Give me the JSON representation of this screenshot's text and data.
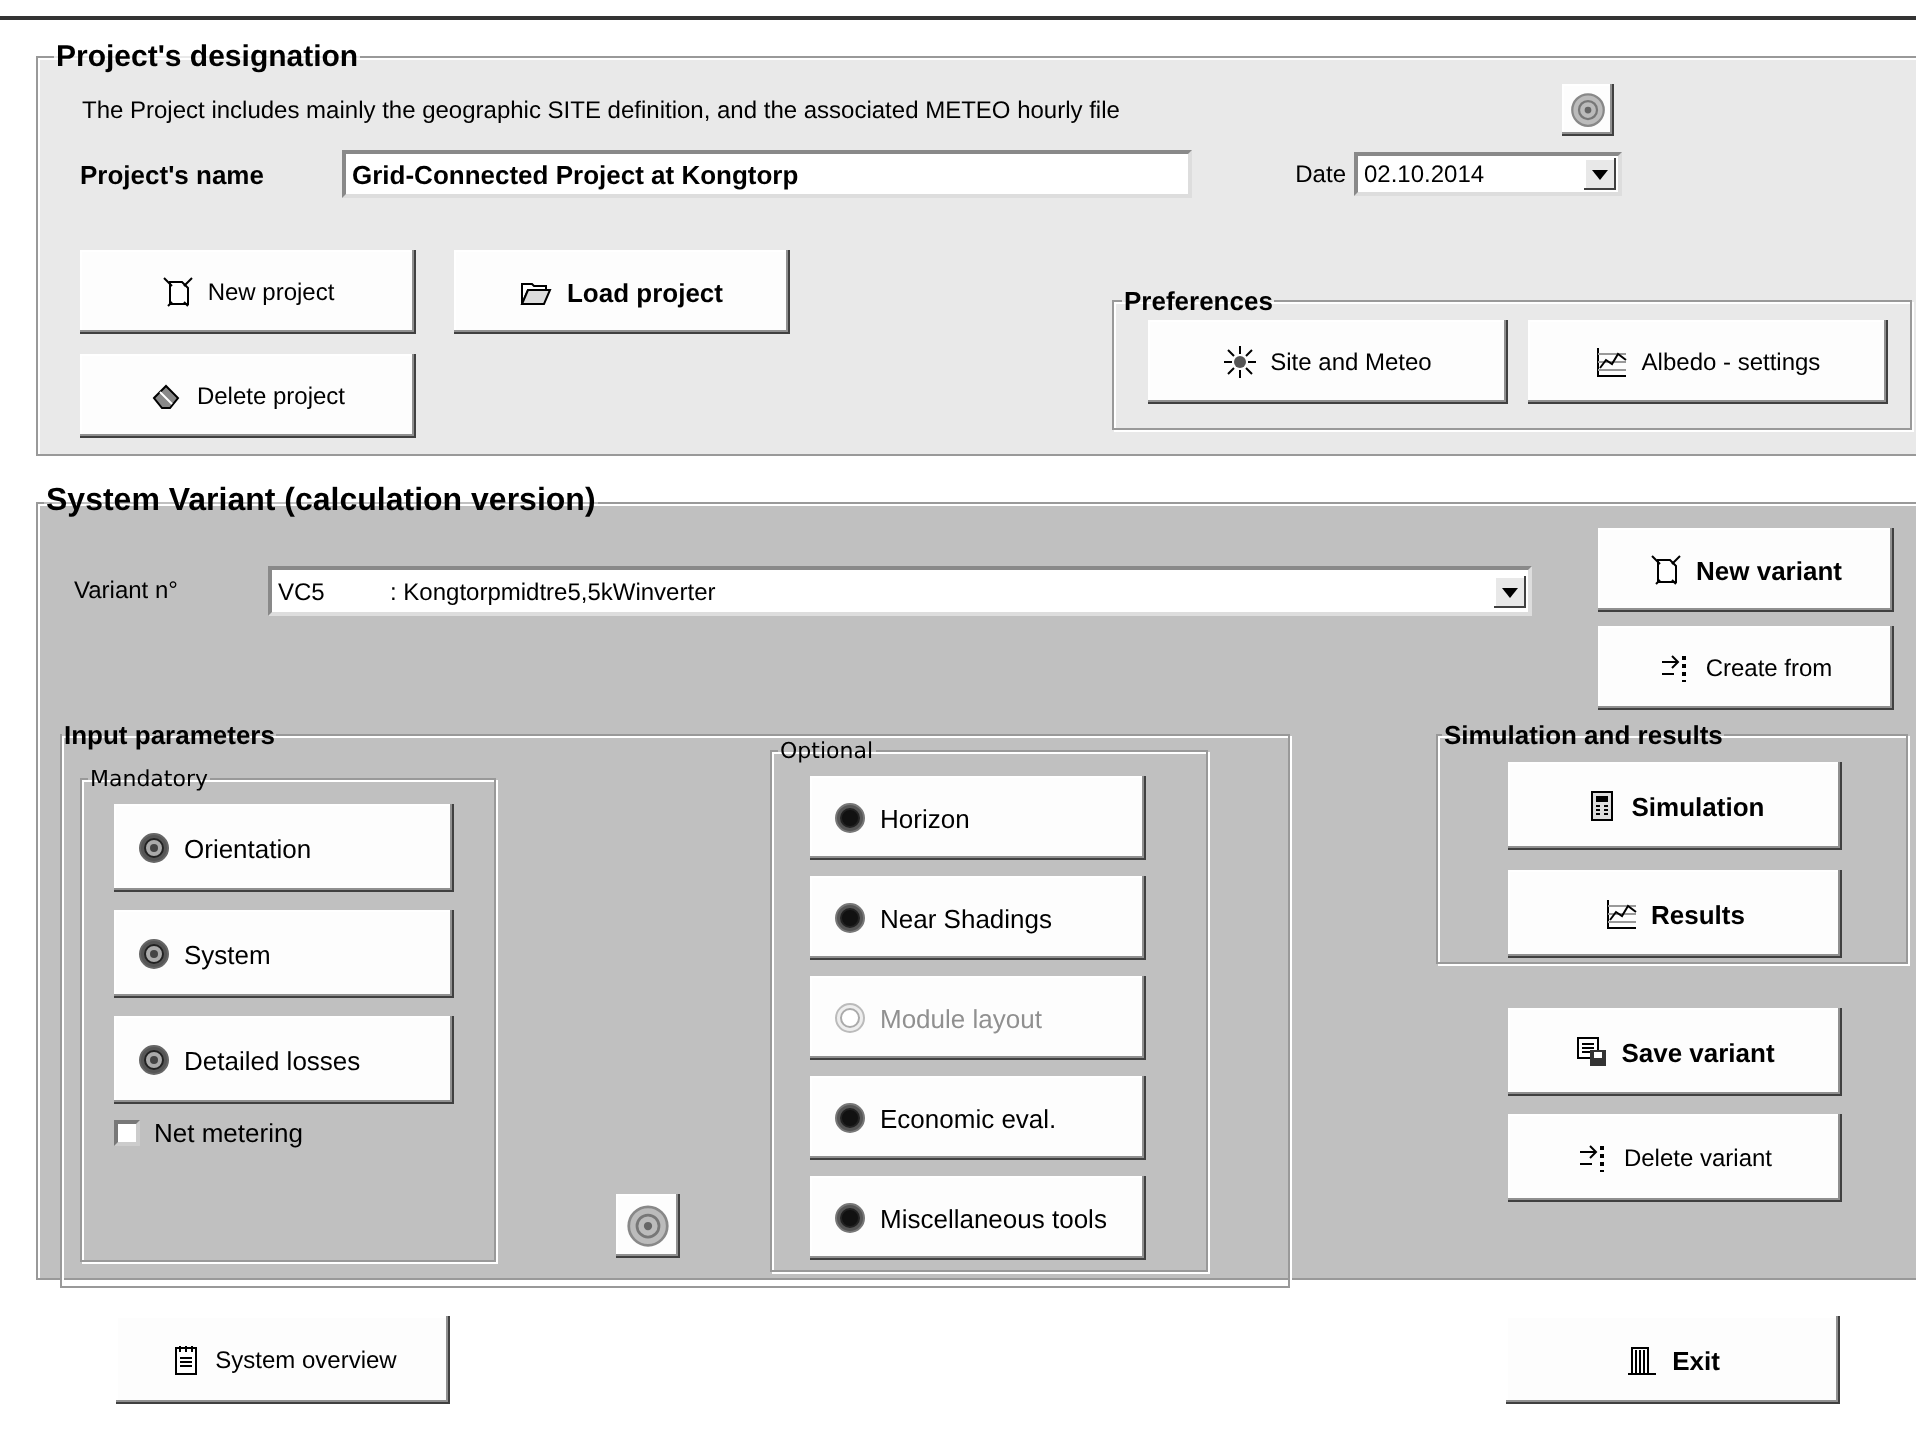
{
  "project": {
    "title": "Project's designation",
    "description": "The Project includes mainly the geographic SITE definition, and the associated  METEO  hourly file",
    "name_label": "Project's name",
    "name_value": "Grid-Connected Project at Kongtorp",
    "date_label": "Date",
    "date_value": "02.10.2014",
    "buttons": [
      {
        "label": "New project"
      },
      {
        "label": "Load project"
      },
      {
        "label": "Delete project"
      }
    ],
    "preferences": {
      "title": "Preferences",
      "buttons": [
        {
          "label": "Site and Meteo"
        },
        {
          "label": "Albedo - settings"
        }
      ]
    }
  },
  "variant": {
    "title": "System Variant (calculation version)",
    "label": "Variant n°",
    "code": "VC5",
    "name": ": Kongtorpmidtre5,5kWinverter",
    "buttons": [
      {
        "label": "New variant"
      },
      {
        "label": "Create from"
      }
    ],
    "input_parameters": {
      "title": "Input parameters",
      "mandatory": {
        "title": "Mandatory",
        "buttons": [
          {
            "label": "Orientation",
            "disabled": false
          },
          {
            "label": "System",
            "disabled": false
          },
          {
            "label": "Detailed losses",
            "disabled": false
          }
        ],
        "checkbox": {
          "label": "Net metering",
          "checked": false
        }
      },
      "optional": {
        "title": "Optional",
        "buttons": [
          {
            "label": "Horizon",
            "disabled": false
          },
          {
            "label": "Near Shadings",
            "disabled": false
          },
          {
            "label": "Module layout",
            "disabled": true
          },
          {
            "label": "Economic eval.",
            "disabled": false
          },
          {
            "label": "Miscellaneous tools",
            "disabled": false
          }
        ]
      }
    },
    "simulation": {
      "title": "Simulation and results",
      "buttons": [
        {
          "label": "Simulation"
        },
        {
          "label": "Results"
        }
      ]
    },
    "variant_buttons": [
      {
        "label": "Save variant"
      },
      {
        "label": "Delete variant"
      }
    ]
  },
  "footer_buttons": [
    {
      "label": "System overview"
    },
    {
      "label": "Exit"
    }
  ]
}
